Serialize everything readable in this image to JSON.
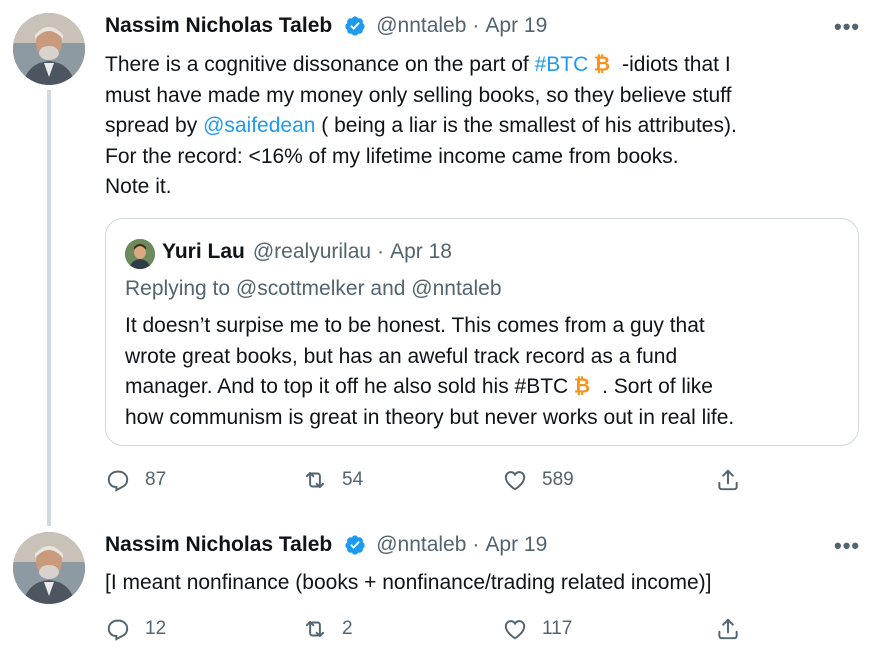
{
  "tweet1": {
    "name": "Nassim Nicholas Taleb",
    "handle": "@nntaleb",
    "sep": "·",
    "date": "Apr 19",
    "more": "•••",
    "line1_pre": "There is a cognitive dissonance on the part of ",
    "hashtag": "#BTC",
    "line1_post": " -idiots that I",
    "line2": "must have made my money only selling books, so they believe stuff",
    "line3_pre": "spread by ",
    "mention": "@saifedean",
    "line3_post": " ( being a liar is the smallest of his attributes).",
    "line4": "For the record: <16% of my lifetime income came from books.",
    "line5": "Note it.",
    "quote": {
      "name": "Yuri Lau",
      "handle": "@realyurilau",
      "sep": "·",
      "date": "Apr 18",
      "replying": "Replying to @scottmelker and @nntaleb",
      "line1": "It doesn’t surpise me to be honest. This comes from a guy that",
      "line2": "wrote great books, but has an aweful track record as a fund",
      "line3_pre": "manager. And to top it off he also sold his #BTC",
      "line3_post": " . Sort of like",
      "line4": "how communism is great in theory but never works out in real life."
    },
    "replies": "87",
    "retweets": "54",
    "likes": "589"
  },
  "tweet2": {
    "name": "Nassim Nicholas Taleb",
    "handle": "@nntaleb",
    "sep": "·",
    "date": "Apr 19",
    "more": "•••",
    "text": "[I meant nonfinance (books + nonfinance/trading related income)]",
    "replies": "12",
    "retweets": "2",
    "likes": "117"
  },
  "colors": {
    "accent": "#1d9bf0",
    "bitcoin": "#f7931a",
    "muted": "#536471",
    "border": "#cfd9de"
  },
  "icons": [
    "verified-badge-icon",
    "bitcoin-icon",
    "reply-icon",
    "retweet-icon",
    "like-icon",
    "share-icon",
    "more-icon"
  ]
}
